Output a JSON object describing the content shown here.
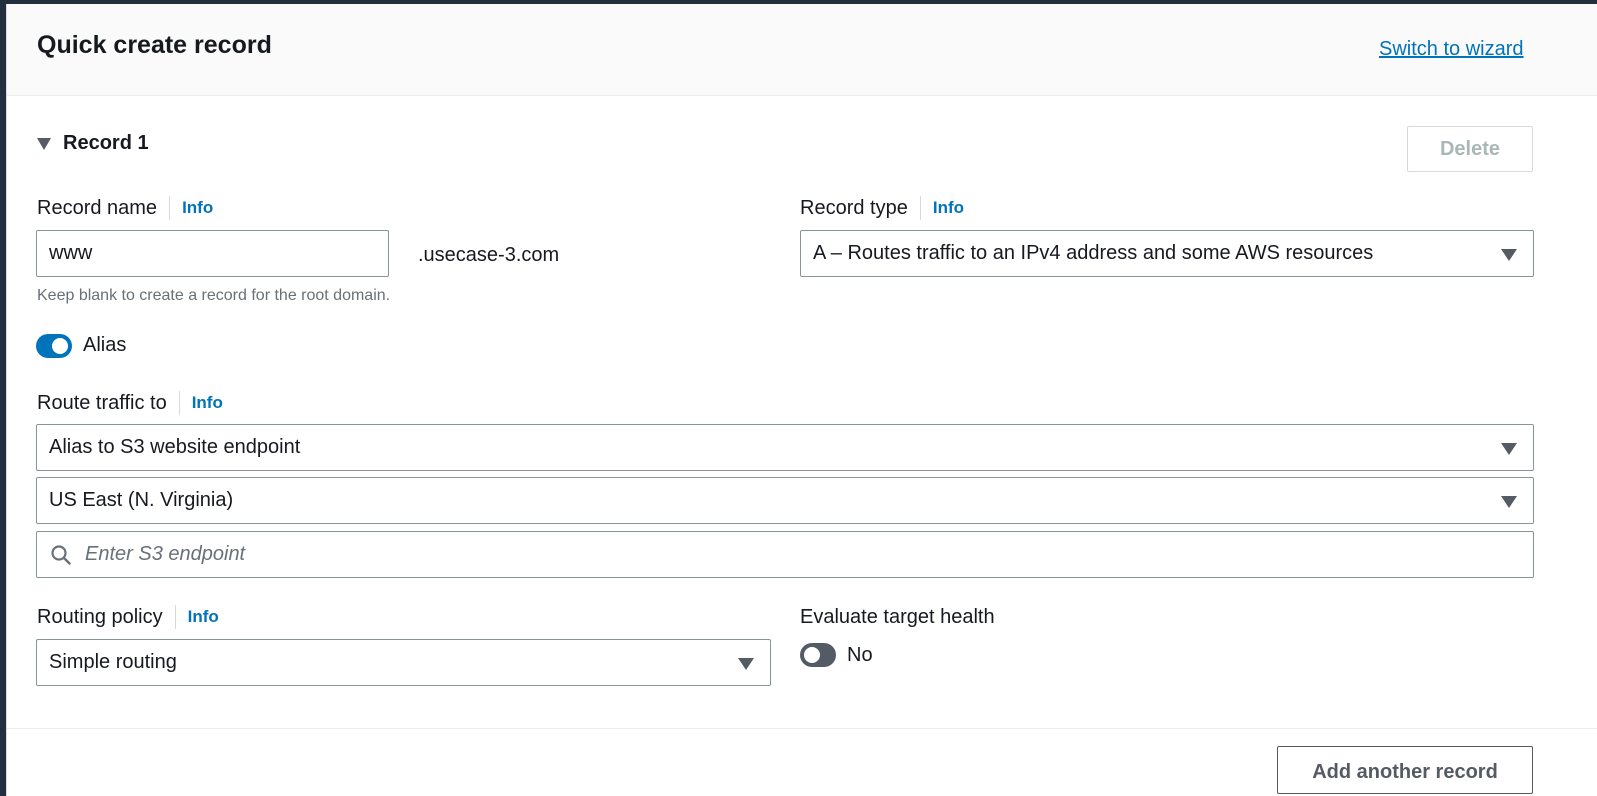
{
  "header": {
    "title": "Quick create record",
    "switch_link": "Switch to wizard"
  },
  "record": {
    "title": "Record 1",
    "delete_label": "Delete",
    "record_name": {
      "label": "Record name",
      "info": "Info",
      "value": "www",
      "suffix": ".usecase-3.com",
      "hint": "Keep blank to create a record for the root domain."
    },
    "record_type": {
      "label": "Record type",
      "info": "Info",
      "value": "A – Routes traffic to an IPv4 address and some AWS resources"
    },
    "alias": {
      "label": "Alias",
      "enabled": true
    },
    "route_traffic": {
      "label": "Route traffic to",
      "info": "Info",
      "endpoint_type": "Alias to S3 website endpoint",
      "region": "US East (N. Virginia)",
      "endpoint_placeholder": "Enter S3 endpoint"
    },
    "routing_policy": {
      "label": "Routing policy",
      "info": "Info",
      "value": "Simple routing"
    },
    "evaluate_health": {
      "label": "Evaluate target health",
      "value": "No",
      "enabled": false
    }
  },
  "footer": {
    "add_label": "Add another record"
  },
  "icons": {
    "search": "search-icon",
    "collapse": "caret-down-icon",
    "select": "chevron-down-icon"
  },
  "colors": {
    "accent": "#0073bb",
    "text": "#16191f",
    "muted": "#687078"
  }
}
